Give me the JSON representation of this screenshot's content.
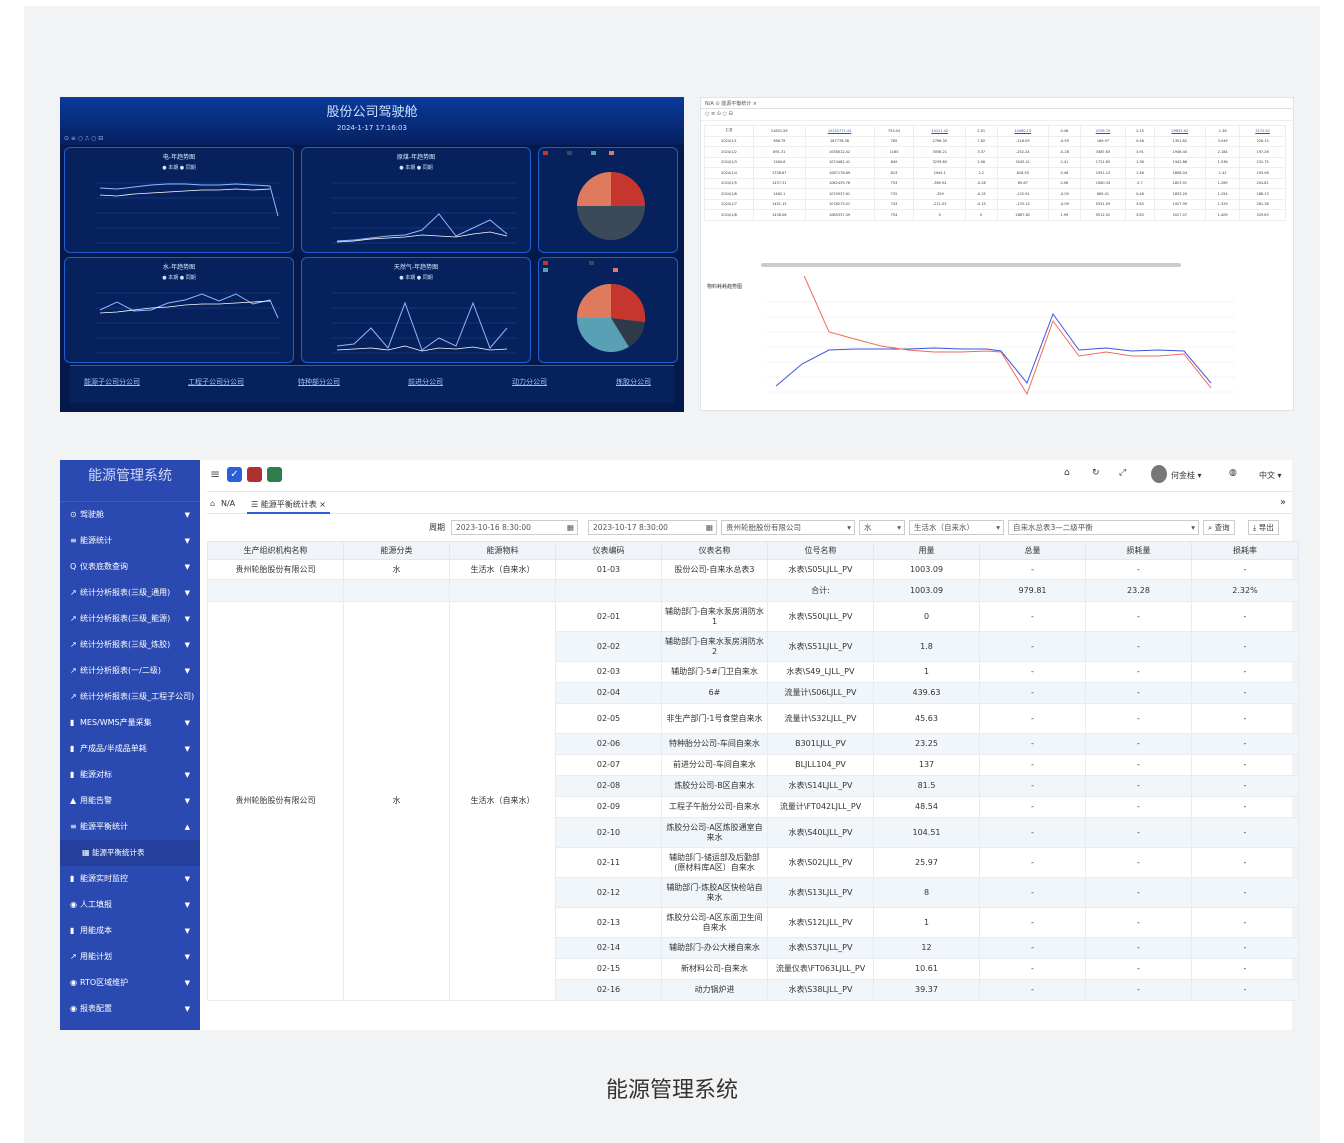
{
  "dashboard": {
    "title": "股份公司驾驶舱",
    "timestamp": "2024-1-17 17:16:03",
    "panels": [
      {
        "title": "电-年趋势图",
        "legend": "● 本期  ● 同期"
      },
      {
        "title": "原煤-年趋势图",
        "legend": "● 本期  ● 同期"
      },
      {
        "title": "水-年趋势图",
        "legend": "● 本期  ● 同期"
      },
      {
        "title": "天然气-年趋势图",
        "legend": "● 本期  ● 同期"
      }
    ],
    "subcompanies": [
      "能源子公司分公司",
      "工程子公司分公司",
      "特种部分公司",
      "前进分公司",
      "动力分公司",
      "炼胶分公司"
    ]
  },
  "table_shot": {
    "tabs": "N/A  ⊙ 能源平衡统计 ×",
    "chart_title": "物料耗耗趋势图",
    "rows": [
      [
        "汇总",
        "21831.59",
        "10152771.43",
        "753.04",
        "44121.42",
        "2.01",
        "10480.13",
        "0.48",
        "4709.75",
        "2.15",
        "29825.02",
        "1.36",
        "3172.52"
      ],
      [
        "2024/1/1",
        "366.79",
        "287776.38",
        "785",
        "2796.30",
        "7.62",
        "-218.09",
        "-0.59",
        "169.97",
        "0.46",
        "1301.62",
        "3.549",
        "226.15"
      ],
      [
        "2024/1/2",
        "891.31",
        "1058012.42",
        "1165",
        "3056.21",
        "3.37",
        "-252.24",
        "-0.28",
        "3487.63",
        "3.91",
        "1946.40",
        "2.184",
        "197.26"
      ],
      [
        "2024/1/3",
        "1264.6",
        "1074462.41",
        "849",
        "3239.60",
        "2.56",
        "3045.21",
        "2.41",
        "1721.63",
        "1.36",
        "1942.86",
        "1.536",
        "231.75"
      ],
      [
        "2024/1/4",
        "1336.67",
        "1087176.89",
        "813",
        "2944.1",
        "2.2",
        "618.55",
        "0.46",
        "1951.15",
        "1.46",
        "1898.04",
        "1.42",
        "193.06"
      ],
      [
        "2024/1/5",
        "1437.31",
        "1082439.76",
        "753",
        "-369.54",
        "-0.26",
        "85.67",
        "0.06",
        "1080.34",
        "0.7",
        "1823.91",
        "1.269",
        "204.81"
      ],
      [
        "2024/1/6",
        "1462.1",
        "1070937.61",
        "732",
        "-359",
        "-0.25",
        "-132.91",
        "-0.09",
        "665.41",
        "0.46",
        "1833.20",
        "1.254",
        "188.13"
      ],
      [
        "2024/1/7",
        "1451.13",
        "1078273.01",
        "743",
        "-211.02",
        "-0.15",
        "-133.13",
        "-0.09",
        "5551.09",
        "3.83",
        "1927.99",
        "1.329",
        "261.38"
      ],
      [
        "2024/1/8",
        "1438.06",
        "1085337.49",
        "754",
        "0",
        "0",
        "2867.62",
        "1.99",
        "5512.52",
        "3.83",
        "2027.07",
        "1.409",
        "329.63"
      ]
    ]
  },
  "system": {
    "brand": "能源管理系统",
    "menu": [
      {
        "icon": "⊙",
        "label": "驾驶舱",
        "arrow": "▼"
      },
      {
        "icon": "≡",
        "label": "能源统计",
        "arrow": "▼"
      },
      {
        "icon": "Q",
        "label": "仪表底数查询",
        "arrow": "▼"
      },
      {
        "icon": "↗",
        "label": "统计分析报表(三级_通用)",
        "arrow": "▼"
      },
      {
        "icon": "↗",
        "label": "统计分析报表(三级_能源)",
        "arrow": "▼"
      },
      {
        "icon": "↗",
        "label": "统计分析报表(三级_炼胶)",
        "arrow": "▼"
      },
      {
        "icon": "↗",
        "label": "统计分析报表(一/二级)",
        "arrow": "▼"
      },
      {
        "icon": "↗",
        "label": "统计分析报表(三级_工程子公司)",
        "arrow": ""
      },
      {
        "icon": "▮",
        "label": "MES/WMS产量采集",
        "arrow": "▼"
      },
      {
        "icon": "▮",
        "label": "产成品/半成品单耗",
        "arrow": "▼"
      },
      {
        "icon": "▮",
        "label": "能源对标",
        "arrow": "▼"
      },
      {
        "icon": "▲",
        "label": "用能告警",
        "arrow": "▼"
      },
      {
        "icon": "≡",
        "label": "能源平衡统计",
        "arrow": "▲"
      },
      {
        "icon": "▦",
        "label": "能源平衡统计表",
        "arrow": "",
        "sub": true
      },
      {
        "icon": "▮",
        "label": "能源实时监控",
        "arrow": "▼"
      },
      {
        "icon": "◉",
        "label": "人工填报",
        "arrow": "▼"
      },
      {
        "icon": "▮",
        "label": "用能成本",
        "arrow": "▼"
      },
      {
        "icon": "↗",
        "label": "用能计划",
        "arrow": "▼"
      },
      {
        "icon": "◉",
        "label": "RTO区域维护",
        "arrow": "▼"
      },
      {
        "icon": "◉",
        "label": "报表配置",
        "arrow": "▼"
      }
    ],
    "topbar": {
      "user": "何金桂 ▾",
      "lang": "中文 ▾"
    },
    "breadcrumb": "N/A",
    "tab_label": "能源平衡统计表",
    "filters": {
      "period_label": "周期",
      "start": "2023-10-16 8:30:00",
      "end": "2023-10-17 8:30:00",
      "company": "贵州轮胎股份有限公司",
      "type": "水",
      "material": "生活水（自来水）",
      "meter": "自来水总表3—二级平衡",
      "query": "查询",
      "export": "导出"
    },
    "headers": [
      "生产组织机构名称",
      "能源分类",
      "能源物料",
      "仪表编码",
      "仪表名称",
      "位号名称",
      "用量",
      "总量",
      "损耗量",
      "损耗率"
    ],
    "top_row": [
      "贵州轮胎股份有限公司",
      "水",
      "生活水（自来水）",
      "01-03",
      "股份公司-自来水总表3",
      "水表\\S05LJLL_PV",
      "1003.09",
      "-",
      "-",
      "-"
    ],
    "sum_row": {
      "label": "合计:",
      "usage": "1003.09",
      "total": "979.81",
      "loss": "23.28",
      "rate": "2.32%"
    },
    "group": {
      "org": "贵州轮胎股份有限公司",
      "category": "水",
      "material": "生活水（自来水）"
    },
    "rows": [
      {
        "code": "02-01",
        "name": "辅助部门-自来水泵房消防水1",
        "tag": "水表\\S50LJLL_PV",
        "usage": "0",
        "total": "-",
        "loss": "-",
        "rate": "-"
      },
      {
        "code": "02-02",
        "name": "辅助部门-自来水泵房消防水2",
        "tag": "水表\\S51LJLL_PV",
        "usage": "1.8",
        "total": "-",
        "loss": "-",
        "rate": "-"
      },
      {
        "code": "02-03",
        "name": "辅助部门-5#门卫自来水",
        "tag": "水表\\S49_LJLL_PV",
        "usage": "1",
        "total": "-",
        "loss": "-",
        "rate": "-"
      },
      {
        "code": "02-04",
        "name": "6#",
        "tag": "流量计\\S06LJLL_PV",
        "usage": "439.63",
        "total": "-",
        "loss": "-",
        "rate": "-"
      },
      {
        "code": "02-05",
        "name": "非生产部门-1号食堂自来水",
        "tag": "流量计\\S32LJLL_PV",
        "usage": "45.63",
        "total": "-",
        "loss": "-",
        "rate": "-"
      },
      {
        "code": "02-06",
        "name": "特种胎分公司-车间自来水",
        "tag": "B301LJLL_PV",
        "usage": "23.25",
        "total": "-",
        "loss": "-",
        "rate": "-"
      },
      {
        "code": "02-07",
        "name": "前进分公司-车间自来水",
        "tag": "BLJLL104_PV",
        "usage": "137",
        "total": "-",
        "loss": "-",
        "rate": "-"
      },
      {
        "code": "02-08",
        "name": "炼胶分公司-B区自来水",
        "tag": "水表\\S14LJLL_PV",
        "usage": "81.5",
        "total": "-",
        "loss": "-",
        "rate": "-"
      },
      {
        "code": "02-09",
        "name": "工程子午胎分公司-自来水",
        "tag": "流量计\\FT042LJLL_PV",
        "usage": "48.54",
        "total": "-",
        "loss": "-",
        "rate": "-"
      },
      {
        "code": "02-10",
        "name": "炼胶分公司-A区炼胶通室自来水",
        "tag": "水表\\S40LJLL_PV",
        "usage": "104.51",
        "total": "-",
        "loss": "-",
        "rate": "-"
      },
      {
        "code": "02-11",
        "name": "辅助部门-储运部及后勤部(原材料库A区）自来水",
        "tag": "水表\\S02LJLL_PV",
        "usage": "25.97",
        "total": "-",
        "loss": "-",
        "rate": "-"
      },
      {
        "code": "02-12",
        "name": "辅助部门-炼胶A区快检站自来水",
        "tag": "水表\\S13LJLL_PV",
        "usage": "8",
        "total": "-",
        "loss": "-",
        "rate": "-"
      },
      {
        "code": "02-13",
        "name": "炼胶分公司-A区东面卫生间自来水",
        "tag": "水表\\S12LJLL_PV",
        "usage": "1",
        "total": "-",
        "loss": "-",
        "rate": "-"
      },
      {
        "code": "02-14",
        "name": "辅助部门-办公大楼自来水",
        "tag": "水表\\S37LJLL_PV",
        "usage": "12",
        "total": "-",
        "loss": "-",
        "rate": "-"
      },
      {
        "code": "02-15",
        "name": "新材料公司-自来水",
        "tag": "流量仪表\\FT063LJLL_PV",
        "usage": "10.61",
        "total": "-",
        "loss": "-",
        "rate": "-"
      },
      {
        "code": "02-16",
        "name": "动力锅炉进",
        "tag": "水表\\S38LJLL_PV",
        "usage": "39.37",
        "total": "-",
        "loss": "-",
        "rate": "-"
      }
    ]
  },
  "caption": "能源管理系统",
  "colors": {
    "sidebar": "#2b4ab1",
    "dash_bg": "#051a4a",
    "accent_green": "#2e7d4f",
    "accent_red": "#b03030",
    "accent_blue": "#2b5fd9"
  }
}
